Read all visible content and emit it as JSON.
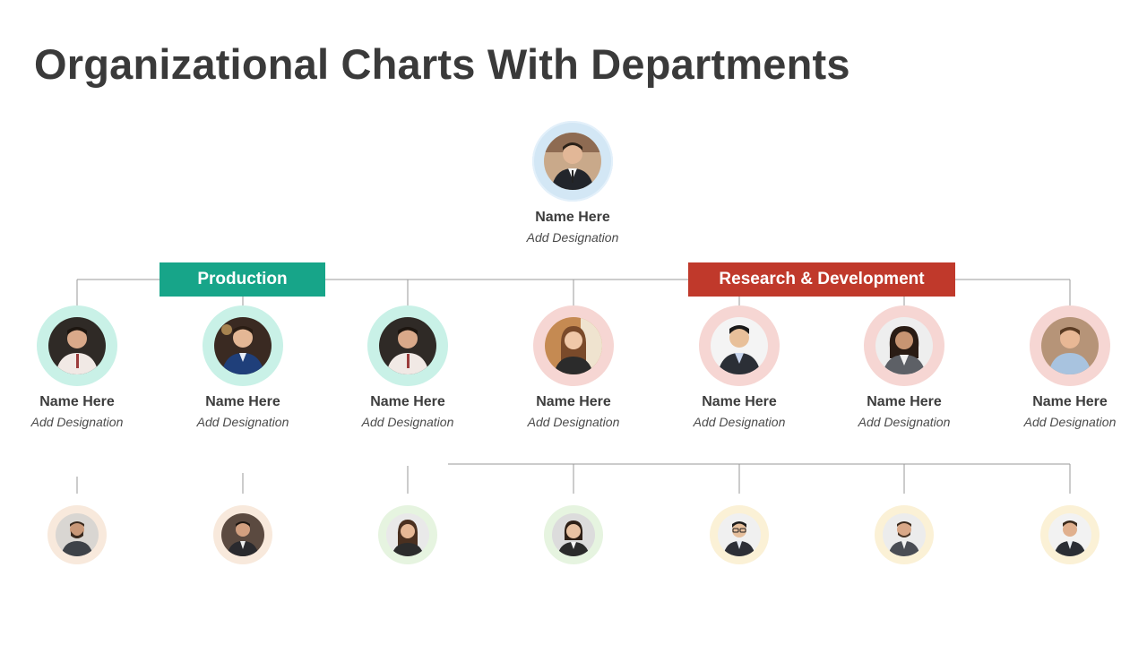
{
  "title": "Organizational Charts With Departments",
  "departments": {
    "production": "Production",
    "research": "Research & Development"
  },
  "top": {
    "name": "Name Here",
    "designation": "Add Designation"
  },
  "members": [
    {
      "name": "Name Here",
      "designation": "Add Designation"
    },
    {
      "name": "Name Here",
      "designation": "Add Designation"
    },
    {
      "name": "Name Here",
      "designation": "Add Designation"
    },
    {
      "name": "Name Here",
      "designation": "Add Designation"
    },
    {
      "name": "Name Here",
      "designation": "Add Designation"
    },
    {
      "name": "Name Here",
      "designation": "Add Designation"
    },
    {
      "name": "Name Here",
      "designation": "Add Designation"
    }
  ],
  "colors": {
    "production": "#17a589",
    "research": "#c0392b",
    "line": "#9a9a9a"
  }
}
